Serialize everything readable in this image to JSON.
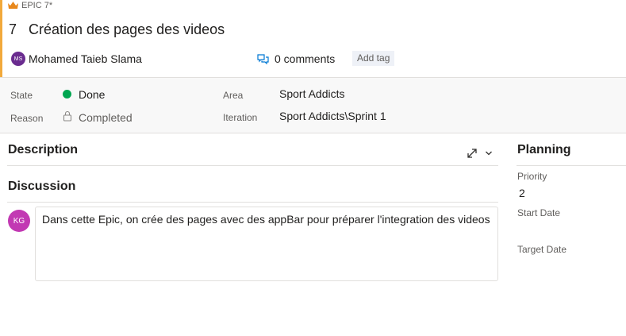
{
  "colors": {
    "accent": "#f2a93b",
    "done": "#00a651",
    "avatar_ms": "#6a2c8f",
    "avatar_kg": "#c239b3",
    "link_icon": "#0078d4"
  },
  "breadcrumb": {
    "icon": "crown-icon",
    "label": "EPIC 7*"
  },
  "work_item": {
    "id": "7",
    "title": "Création des pages des videos"
  },
  "meta": {
    "assignee_initials": "MS",
    "assignee": "Mohamed Taieb Slama",
    "comments": "0 comments",
    "add_tag": "Add tag"
  },
  "fields": {
    "state_label": "State",
    "state_value": "Done",
    "reason_label": "Reason",
    "reason_value": "Completed",
    "area_label": "Area",
    "area_value": "Sport Addicts",
    "iteration_label": "Iteration",
    "iteration_value": "Sport Addicts\\Sprint 1"
  },
  "description": {
    "title": "Description"
  },
  "discussion": {
    "title": "Discussion",
    "author_initials": "KG",
    "text": "Dans cette Epic, on crée des pages avec des appBar pour préparer l'integration des videos"
  },
  "planning": {
    "title": "Planning",
    "priority_label": "Priority",
    "priority_value": "2",
    "start_label": "Start Date",
    "target_label": "Target Date"
  }
}
